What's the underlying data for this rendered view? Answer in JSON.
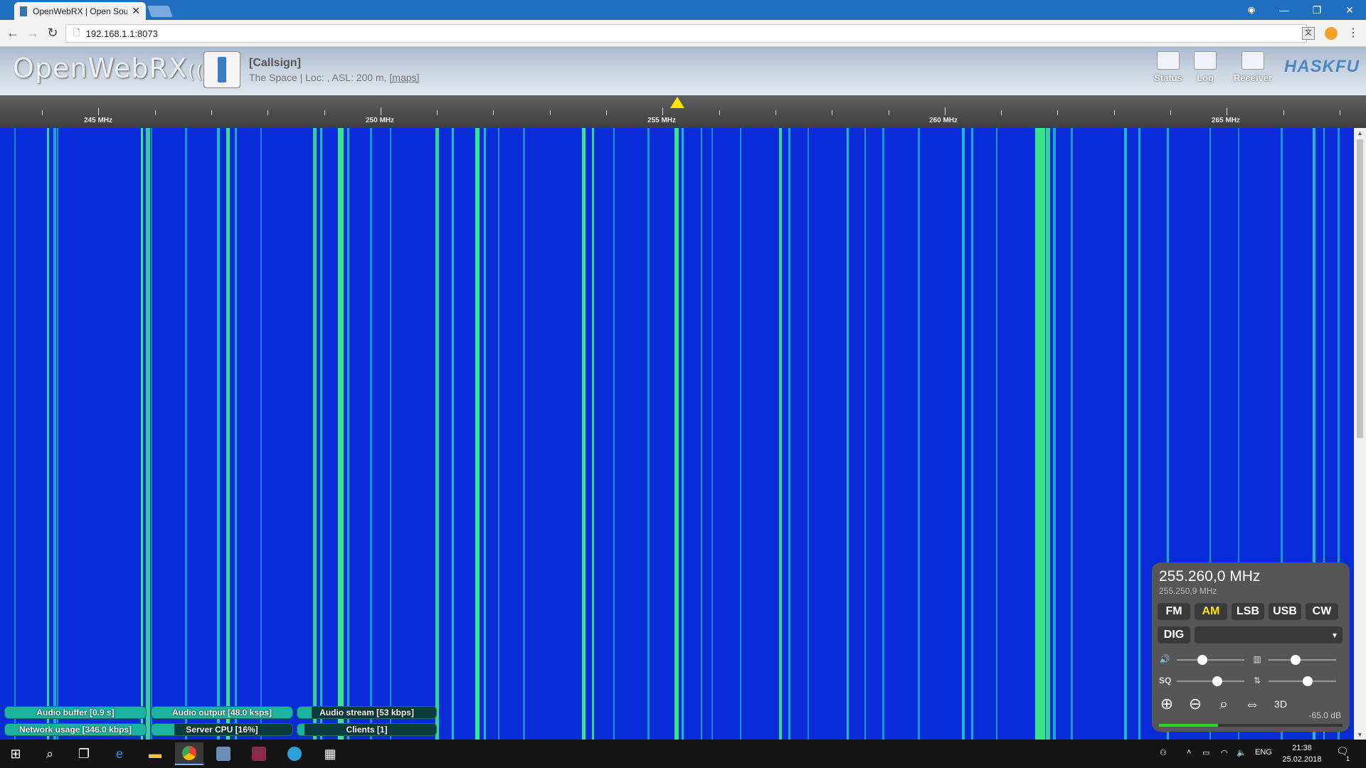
{
  "browser": {
    "tab_title": "OpenWebRX | Open Sou",
    "url": "192.168.1.1:8073"
  },
  "header": {
    "logo_text": "OpenWebRX",
    "callsign": "[Callsign]",
    "location_text": "The Space | Loc: , ASL: 200 m, ",
    "maps_link": "[maps]",
    "buttons": [
      "Status",
      "Log",
      "Receiver"
    ],
    "brand": "HASKFU"
  },
  "scale": {
    "labels": [
      "245 MHz",
      "250 MHz",
      "255 MHz",
      "260 MHz",
      "265 MHz"
    ]
  },
  "status_bars": [
    {
      "label": "Audio buffer [0.9 s]",
      "fill": 1.0
    },
    {
      "label": "Audio output [48.0 ksps]",
      "fill": 1.0
    },
    {
      "label": "Audio stream [53 kbps]",
      "fill": 0.1
    },
    {
      "label": "Network usage [346.0 kbps]",
      "fill": 1.0
    },
    {
      "label": "Server CPU [16%]",
      "fill": 0.16
    },
    {
      "label": "Clients [1]",
      "fill": 0.05
    }
  ],
  "receiver": {
    "frequency": "255.260,0 MHz",
    "frequency_secondary": "255.250,9 MHz",
    "modes": [
      "FM",
      "AM",
      "LSB",
      "USB",
      "CW"
    ],
    "active_mode": "AM",
    "dig_label": "DIG",
    "dig_select_arrow": "▾",
    "volume_level": 0.38,
    "squelch_label": "SQ",
    "squelch_level": 0.6,
    "nr_level": 0.4,
    "ag_level": 0.58,
    "db_value": "-65.0 dB",
    "smeter_level": 0.32
  },
  "taskbar": {
    "lang": "ENG",
    "time": "21:38",
    "date": "25.02.2018",
    "notifications": "1"
  },
  "colors": {
    "waterfall_bg": "#0a2bd8",
    "signal_cyan": "#1ee0c8",
    "signal_green": "#39e58a",
    "marker_yellow": "#ffe400"
  }
}
